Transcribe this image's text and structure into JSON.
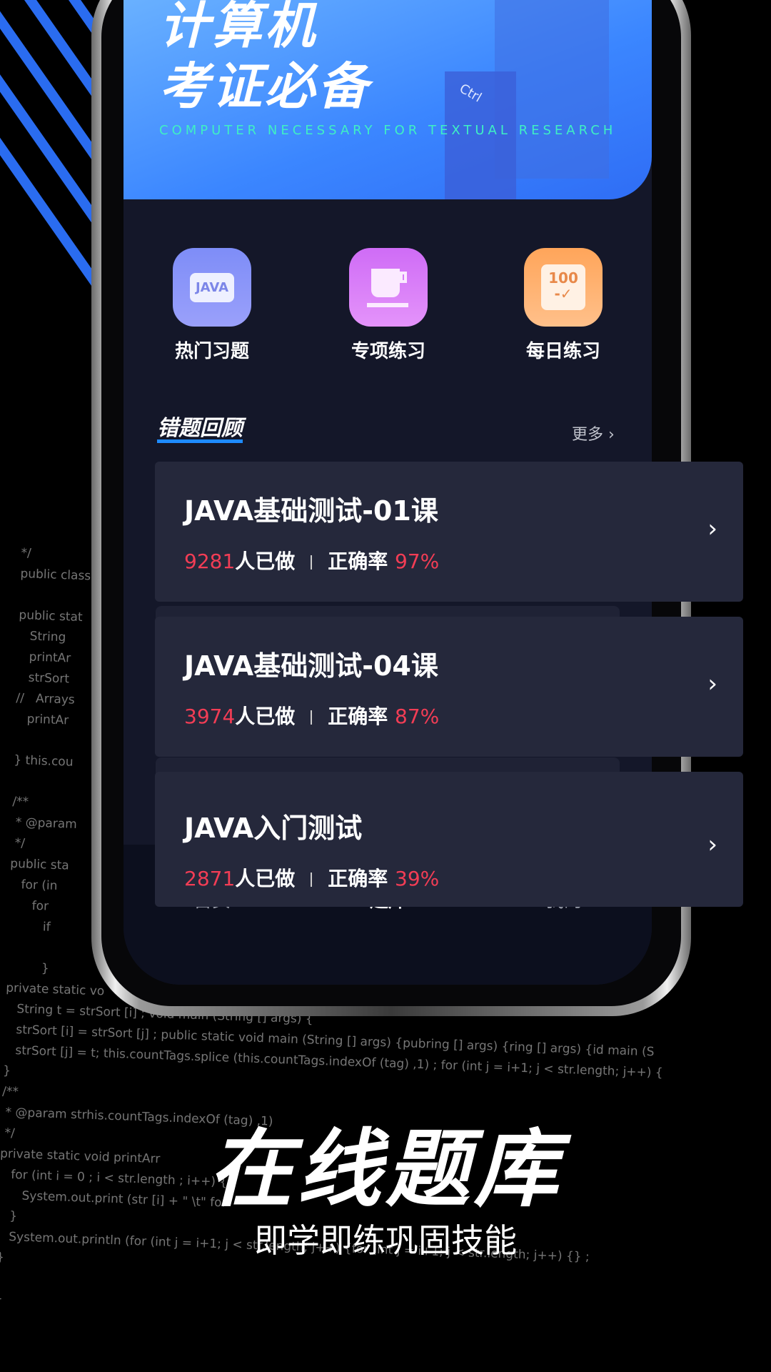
{
  "banner": {
    "line1": "计算机",
    "line2": "考证必备",
    "tagline": "COMPUTER NECESSARY FOR TEXTUAL RESEARCH",
    "key_label": "Ctrl"
  },
  "shortcuts": [
    {
      "label": "热门习题",
      "icon": "java-chat-icon",
      "color": "#8a93f8"
    },
    {
      "label": "专项练习",
      "icon": "cup-icon",
      "color": "#d884f7"
    },
    {
      "label": "每日练习",
      "icon": "score-100-icon",
      "color": "#ffaa66"
    }
  ],
  "review": {
    "title": "错题回顾",
    "more": "更多"
  },
  "cards": [
    {
      "title": "JAVA基础测试-01课",
      "count": "9281",
      "count_suffix": "人已做",
      "rate_label": "正确率",
      "rate": "97%"
    },
    {
      "title": "JAVA基础测试-04课",
      "count": "3974",
      "count_suffix": "人已做",
      "rate_label": "正确率",
      "rate": "87%"
    },
    {
      "title": "JAVA入门测试",
      "count": "2871",
      "count_suffix": "人已做",
      "rate_label": "正确率",
      "rate": "39%"
    }
  ],
  "nav": [
    {
      "label": "首页"
    },
    {
      "label": "题库",
      "active": true
    },
    {
      "label": "我的"
    }
  ],
  "headline": "在线题库",
  "subheadline": "即学即练巩固技能",
  "code_lines": [
    "*/",
    "public class",
    "",
    "public stat",
    "   String",
    "   printAr",
    "   strSort",
    "//   Arrays",
    "   printAr",
    "",
    "} this.cou",
    "",
    "/**",
    " * @param",
    " */",
    "public sta",
    "   for (in",
    "      for",
    "         if",
    "",
    "         }",
    "private static vo",
    "   String t = strSort [i] ; void main (String [] args) {",
    "   strSort [i] = strSort [j] ; public static void main (String [] args) {pubring [] args) {ring [] args) {id main (S",
    "   strSort [j] = t; this.countTags.splice (this.countTags.indexOf (tag) ,1) ; for (int j = i+1; j < str.length; j++) {",
    "}",
    "/**",
    " * @param strhis.countTags.indexOf (tag) ,1)",
    " */",
    "private static void printArr",
    "   for (int i = 0 ; i < str.length ; i++) {",
    "      System.out.print (str [i] + \" \\t\" for",
    "   }",
    "   System.out.println (for (int j = i+1; j < str.length; j++) {for (int j = i+1; j < str.length; j++) {} ;",
    "}",
    "",
    "}"
  ],
  "colors": {
    "accent": "#2a6cf0",
    "highlight": "#f23d55",
    "card": "#25283b",
    "screen": "#141729"
  }
}
